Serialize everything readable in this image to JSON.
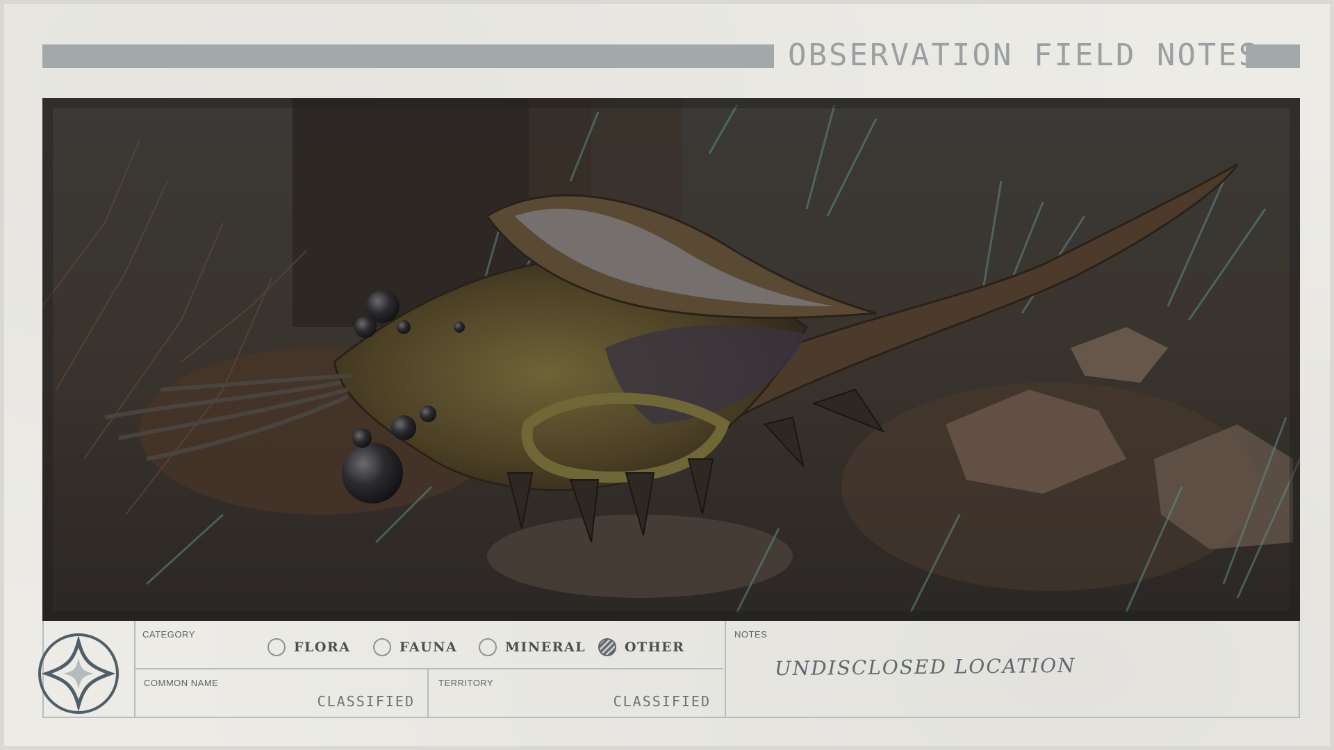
{
  "header": {
    "title": "OBSERVATION FIELD NOTES"
  },
  "photo": {
    "subject": "creature-photo"
  },
  "category": {
    "label": "CATEGORY",
    "options": [
      {
        "label": "FLORA",
        "selected": false
      },
      {
        "label": "FAUNA",
        "selected": false
      },
      {
        "label": "MINERAL",
        "selected": false
      },
      {
        "label": "OTHER",
        "selected": true
      }
    ]
  },
  "common_name": {
    "label": "COMMON NAME",
    "value": "CLASSIFIED"
  },
  "territory": {
    "label": "TERRITORY",
    "value": "CLASSIFIED"
  },
  "notes": {
    "label": "NOTES",
    "value": "UNDISCLOSED LOCATION"
  },
  "colors": {
    "card": "#ecebe6",
    "header_bar": "#a3a8aa",
    "border": "#b7bcbe",
    "text_dark": "#4a4f52"
  }
}
